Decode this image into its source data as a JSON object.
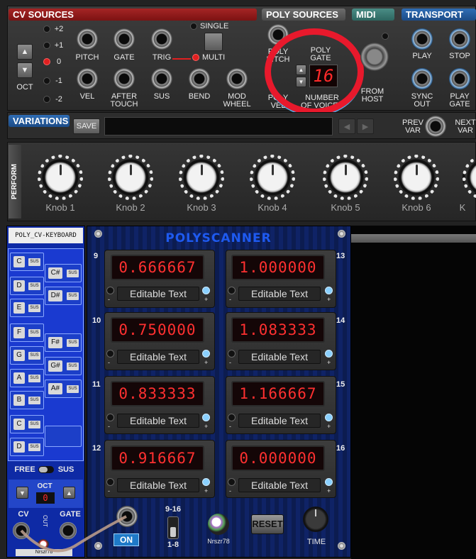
{
  "cv_sources": {
    "title": "CV SOURCES",
    "oct_levels": [
      "+2",
      "+1",
      "0",
      "-1",
      "-2"
    ],
    "oct_label": "OCT",
    "jacks_row1": [
      "PITCH",
      "GATE",
      "TRIG"
    ],
    "jacks_row2": [
      "VEL",
      "AFTER TOUCH",
      "SUS",
      "BEND",
      "MOD WHEEL"
    ],
    "single_label": "SINGLE",
    "multi_label": "MULTI"
  },
  "poly_sources": {
    "title": "POLY SOURCES",
    "poly_gate": "POLY GATE",
    "left_top": "POLY PITCH",
    "left_bottom": "POLY VEL",
    "voices_value": "16",
    "voices_label": "NUMBER OF VOICES"
  },
  "midi": {
    "title": "MIDI",
    "from_host": "FROM HOST"
  },
  "transport": {
    "title": "TRANSPORT",
    "labels": [
      "PLAY",
      "STOP",
      "SYNC OUT",
      "PLAY GATE"
    ]
  },
  "variations": {
    "title": "VARIATIONS",
    "save": "SAVE",
    "prev": "PREV VAR",
    "next": "NEXT VAR"
  },
  "perform": {
    "title": "PERFORM",
    "knobs": [
      "Knob 1",
      "Knob 2",
      "Knob 3",
      "Knob 4",
      "Knob 5",
      "Knob 6",
      "K"
    ]
  },
  "keyboard": {
    "title": "POLY_CV-KEYBOARD",
    "white_keys": [
      "C",
      "D",
      "E",
      "F",
      "G",
      "A",
      "B",
      "C",
      "D"
    ],
    "black_keys": [
      "C#",
      "D#",
      "F#",
      "G#",
      "A#"
    ],
    "sus": "SUS",
    "free": "FREE",
    "sus_toggle": "SUS",
    "oct_label": "OCT",
    "oct_value": "0",
    "cv": "CV",
    "gate": "GATE",
    "out": "OUT",
    "brand": "Nrszr78"
  },
  "polyscanner": {
    "title": "POLYSCANNER",
    "cells": [
      {
        "index": "9",
        "value": "0.666667",
        "text": "Editable Text"
      },
      {
        "index": "13",
        "value": "1.000000",
        "text": "Editable Text"
      },
      {
        "index": "10",
        "value": "0.750000",
        "text": "Editable Text"
      },
      {
        "index": "14",
        "value": "1.083333",
        "text": "Editable Text"
      },
      {
        "index": "11",
        "value": "0.833333",
        "text": "Editable Text"
      },
      {
        "index": "15",
        "value": "1.166667",
        "text": "Editable Text"
      },
      {
        "index": "12",
        "value": "0.916667",
        "text": "Editable Text"
      },
      {
        "index": "16",
        "value": "0.000000",
        "text": "Editable Text"
      }
    ],
    "minus": "-",
    "plus": "+",
    "on": "ON",
    "range_top": "9-16",
    "range_bottom": "1-8",
    "brand": "Nrszr78",
    "reset": "RESET",
    "time": "TIME"
  },
  "colors": {
    "accent_red": "#e02020",
    "panel_blue": "#0d1f58",
    "display_red": "#ff3030"
  }
}
